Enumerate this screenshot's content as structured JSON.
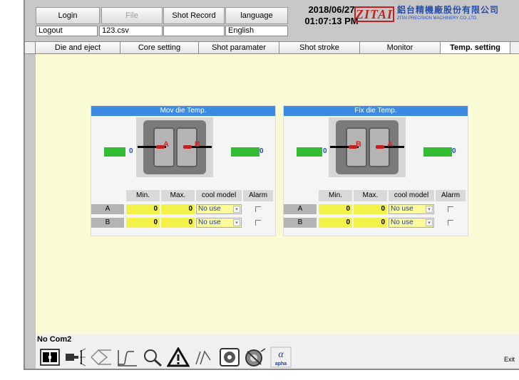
{
  "header": {
    "buttons": [
      {
        "label": "Login"
      },
      {
        "label": "File"
      },
      {
        "label": "Shot Record"
      },
      {
        "label": "language"
      }
    ],
    "values": [
      "Logout",
      "123.csv",
      "",
      "English"
    ],
    "date": "2018/06/27",
    "time": "01:07:13 PM",
    "logo": {
      "mark": "ZITAI",
      "name_cn": "鋁台精機廠股份有限公司",
      "name_en": "ZITAI PRECISION MACHINERY CO.,LTD."
    }
  },
  "tabs": [
    "Die and eject",
    "Core setting",
    "Shot paramater",
    "Shot stroke",
    "Monitor",
    "Temp. setting"
  ],
  "active_tab": "Temp. setting",
  "panels": [
    {
      "title": "Mov die Temp.",
      "left_value": "0",
      "right_value": "0",
      "columns": [
        "Min.",
        "Max.",
        "cool model",
        "Alarm"
      ],
      "rows": [
        {
          "label": "A",
          "min": "0",
          "max": "0",
          "cool": "No use"
        },
        {
          "label": "B",
          "min": "0",
          "max": "0",
          "cool": "No use"
        }
      ]
    },
    {
      "title": "Fix die Temp.",
      "left_value": "0",
      "right_value": "0",
      "columns": [
        "Min.",
        "Max.",
        "cool model",
        "Alarm"
      ],
      "rows": [
        {
          "label": "A",
          "min": "0",
          "max": "0",
          "cool": "No use"
        },
        {
          "label": "B",
          "min": "0",
          "max": "0",
          "cool": "No use"
        }
      ]
    }
  ],
  "pin_labels": {
    "A": "A",
    "B": "B"
  },
  "status": "No Com2",
  "toolbar": {
    "icons": [
      "mold-icon",
      "injection-icon",
      "open-close-icon",
      "curve-icon",
      "search-icon",
      "warning-icon",
      "pen-icon",
      "robot-icon",
      "robot-disabled-icon",
      "alpha-icon"
    ],
    "alpha_text": "apha",
    "exit_label": "Exit"
  },
  "colors": {
    "title_bar": "#3d8be0",
    "cell_yellow": "#f2f24a",
    "bar_green": "#33bb33",
    "pin_red": "#c02020",
    "main_bg": "#fafad4"
  }
}
